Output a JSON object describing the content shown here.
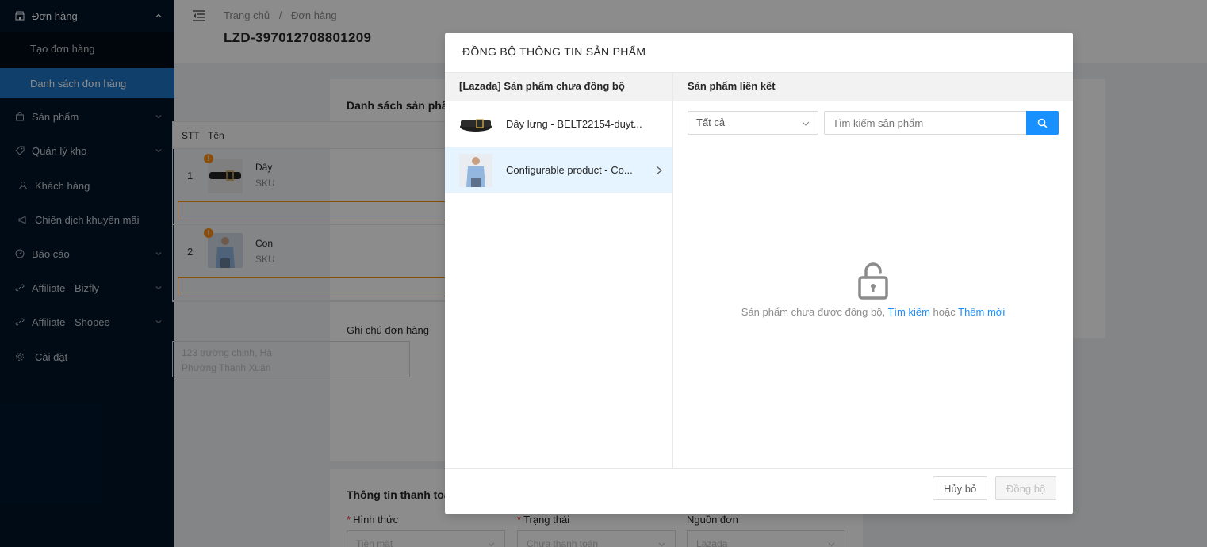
{
  "sidebar": {
    "items": [
      {
        "label": "Đơn hàng"
      },
      {
        "label": "Sản phẩm"
      },
      {
        "label": "Quản lý kho"
      },
      {
        "label": "Khách hàng"
      },
      {
        "label": "Chiến dịch khuyến mãi"
      },
      {
        "label": "Báo cáo"
      },
      {
        "label": "Affiliate - Bizfly"
      },
      {
        "label": "Affiliate - Shopee"
      },
      {
        "label": "Cài đặt"
      }
    ],
    "submenu": [
      {
        "label": "Tạo đơn hàng"
      },
      {
        "label": "Danh sách đơn hàng"
      }
    ]
  },
  "breadcrumb": {
    "home": "Trang chủ",
    "separator": "/",
    "current": "Đơn hàng"
  },
  "order": {
    "title": "LZD-397012708801209"
  },
  "background": {
    "product_list_title": "Danh sách sản phẩ",
    "table": {
      "col_stt": "STT",
      "col_name": "Tên"
    },
    "rows": [
      {
        "stt": "1",
        "name": "Dây",
        "sku": "SKU"
      },
      {
        "stt": "2",
        "name": "Con",
        "sku": "SKU"
      }
    ],
    "note_label": "Ghi chú đơn hàng",
    "note_line1": "123 trường chinh, Hà",
    "note_line2": "Phường Thanh Xuân",
    "payment_title": "Thông tin thanh toá",
    "method_label": "Hình thức",
    "status_label": "Trạng thái",
    "source_label": "Nguồn đơn",
    "method_value": "Tiền mặt",
    "status_value": "Chưa thanh toán",
    "source_value": "Lazada",
    "warn_mark": "!"
  },
  "modal": {
    "title": "ĐỒNG BỘ THÔNG TIN SẢN PHẨM",
    "left_header": "[Lazada] Sản phẩm chưa đồng bộ",
    "right_header": "Sản phẩm liên kết",
    "products": [
      {
        "name": "Dây lưng - BELT22154-duyt..."
      },
      {
        "name": "Configurable product - Co..."
      }
    ],
    "filter_value": "Tất cả",
    "search_placeholder": "Tìm kiếm sản phẩm",
    "empty_text": "Sản phẩm chưa được đồng bộ,",
    "empty_link_search": "Tìm kiếm",
    "empty_or": "hoặc",
    "empty_link_add": "Thêm mới",
    "cancel_label": "Hủy bỏ",
    "sync_label": "Đồng bộ"
  },
  "colors": {
    "sidebar_bg": "#001529",
    "active_item": "#1f73c4",
    "primary": "#1890ff",
    "warning": "#fa8c16"
  }
}
